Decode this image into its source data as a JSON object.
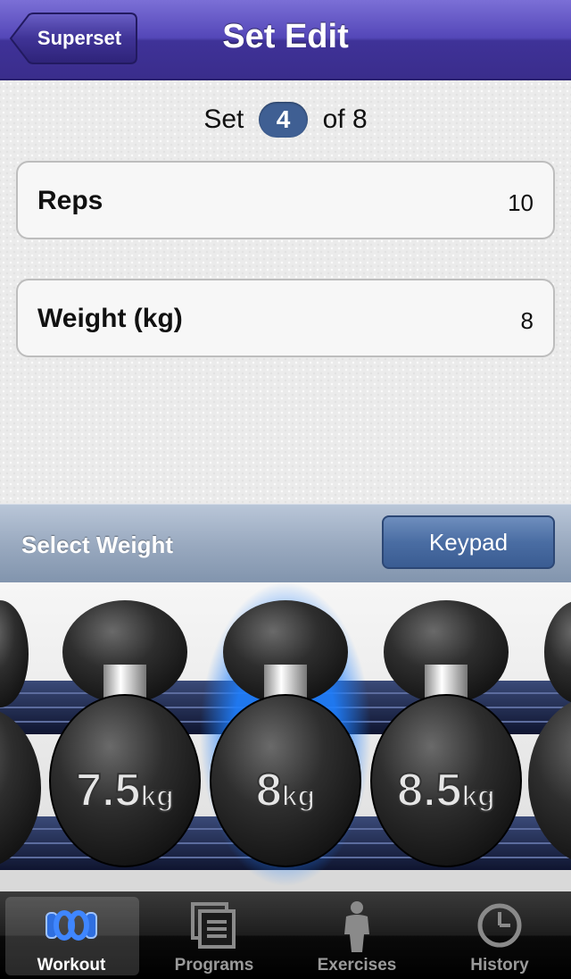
{
  "nav": {
    "back_label": "Superset",
    "title": "Set Edit"
  },
  "set_indicator": {
    "prefix": "Set",
    "current": "4",
    "suffix": "of 8"
  },
  "fields": [
    {
      "label": "Reps",
      "value": "10"
    },
    {
      "label": "Weight (kg)",
      "value": "8"
    }
  ],
  "weight_selector": {
    "caption": "Select Weight",
    "keypad_label": "Keypad",
    "dumbbells": [
      {
        "number": "7.5",
        "unit": "kg"
      },
      {
        "number": "8",
        "unit": "kg"
      },
      {
        "number": "8.5",
        "unit": "kg"
      }
    ],
    "selected_index": 1,
    "highlight_color": "#1e7fff"
  },
  "tabs": [
    {
      "label": "Workout",
      "icon": "workout-icon",
      "active": true
    },
    {
      "label": "Programs",
      "icon": "programs-icon",
      "active": false
    },
    {
      "label": "Exercises",
      "icon": "exercises-icon",
      "active": false
    },
    {
      "label": "History",
      "icon": "history-icon",
      "active": false
    }
  ],
  "colors": {
    "nav_purple": "#4a3da8",
    "badge_blue": "#3f5f93",
    "active_tab_icon": "#2f6fe0"
  }
}
